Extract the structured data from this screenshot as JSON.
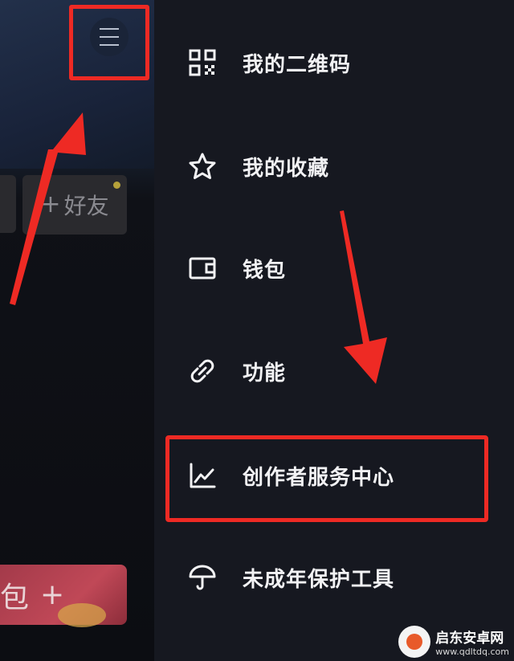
{
  "left_panel": {
    "friend_button": {
      "plus": "+",
      "label": "好友"
    },
    "red_packet": {
      "label": "包",
      "plus": "+"
    }
  },
  "drawer": {
    "items": [
      {
        "icon": "qr-code-icon",
        "label": "我的二维码"
      },
      {
        "icon": "star-icon",
        "label": "我的收藏"
      },
      {
        "icon": "wallet-icon",
        "label": "钱包"
      },
      {
        "icon": "link-icon",
        "label": "功能"
      },
      {
        "icon": "trend-chart-icon",
        "label": "创作者服务中心"
      },
      {
        "icon": "umbrella-icon",
        "label": "未成年保护工具"
      }
    ]
  },
  "watermark": {
    "name": "启东安卓网",
    "url": "www.qdltdq.com"
  },
  "colors": {
    "drawer_bg": "#161820",
    "highlight": "#ee2a24",
    "text": "#f2f2f4"
  }
}
